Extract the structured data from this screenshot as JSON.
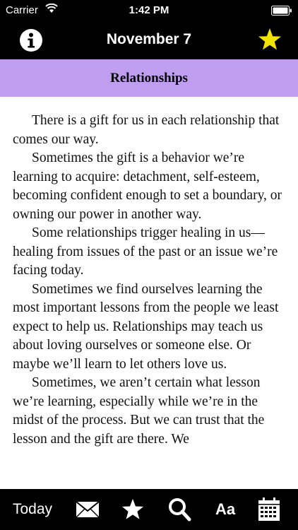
{
  "status_bar": {
    "carrier": "Carrier",
    "time": "1:42 PM"
  },
  "nav": {
    "title": "November 7",
    "info_icon": "info-icon",
    "favorite_icon": "star-icon",
    "favorite_color": "#f2e400"
  },
  "section": {
    "title": "Relationships",
    "band_color": "#bf9ef0"
  },
  "content": {
    "paragraphs": [
      "There is a gift for us in each relationship that comes our way.",
      "Sometimes the gift is a behavior we’re learning to acquire: detachment, self-esteem, becoming confident enough to set a boundary, or owning our power in another way.",
      "Some relationships trigger healing in us—healing from issues of the past or an issue we’re facing today.",
      "Sometimes we find ourselves learning the most important lessons from the people we least expect to help us. Relationships may teach us about loving ourselves or someone else. Or maybe we’ll learn to let others love us.",
      "Sometimes, we aren’t certain what lesson we’re learning, especially while we’re in the midst of the process. But we can trust that the lesson and the gift are there. We"
    ]
  },
  "tab_bar": {
    "today_label": "Today",
    "font_label": "Aa",
    "icons": [
      "mail-icon",
      "star-icon",
      "search-icon",
      "font-size-icon",
      "calendar-icon"
    ]
  }
}
